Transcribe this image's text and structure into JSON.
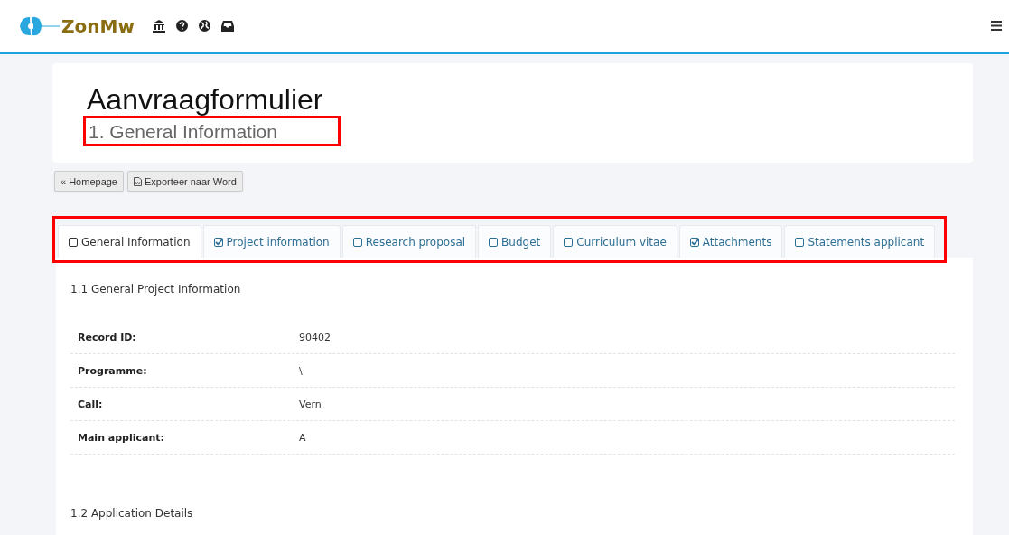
{
  "header": {
    "brand": "ZonMw"
  },
  "page": {
    "title": "Aanvraagformulier",
    "subtitle": "1. General Information",
    "subtitle_highlighted": true
  },
  "buttons": [
    {
      "kind": "back",
      "label": "« Homepage"
    },
    {
      "kind": "export",
      "label": "Exporteer naar Word"
    }
  ],
  "tabs_highlighted": true,
  "tabs": [
    {
      "label": "General Information",
      "checked": false,
      "selected": true
    },
    {
      "label": "Project information",
      "checked": true,
      "selected": false
    },
    {
      "label": "Research proposal",
      "checked": false,
      "selected": false
    },
    {
      "label": "Budget",
      "checked": false,
      "selected": false
    },
    {
      "label": "Curriculum vitae",
      "checked": false,
      "selected": false
    },
    {
      "label": "Attachments",
      "checked": true,
      "selected": false
    },
    {
      "label": "Statements applicant",
      "checked": false,
      "selected": false
    }
  ],
  "sections": [
    {
      "heading": "1.1 General Project Information",
      "fields": [
        {
          "label": "Record ID:",
          "value": "90402"
        },
        {
          "label": "Programme:",
          "value": "\\"
        },
        {
          "label": "Call:",
          "value": "Vern"
        },
        {
          "label": "Main applicant:",
          "value": "A"
        }
      ]
    },
    {
      "heading": "1.2 Application Details"
    }
  ]
}
